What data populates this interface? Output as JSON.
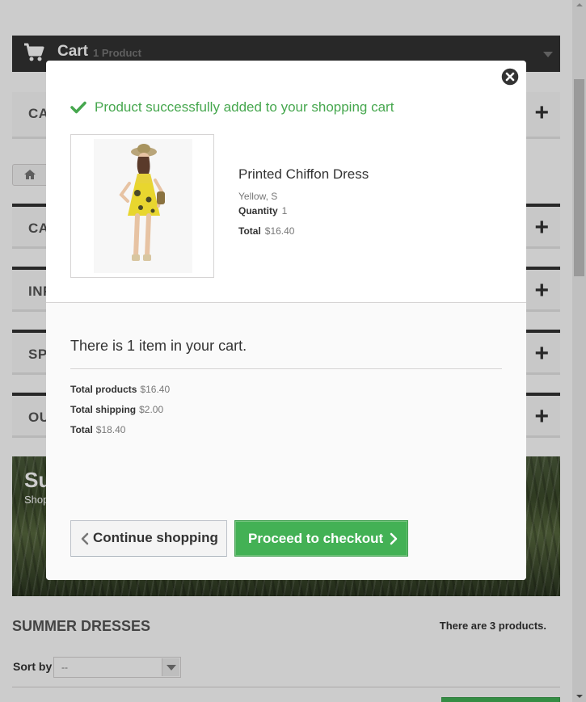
{
  "cart_bar": {
    "title": "Cart",
    "count": "1 Product"
  },
  "side_blocks": [
    {
      "label": "CA"
    },
    {
      "label": "CA"
    },
    {
      "label": "INF"
    },
    {
      "label": "SP"
    },
    {
      "label": "OU"
    }
  ],
  "banner": {
    "title": "Su",
    "subtitle": "Shop"
  },
  "category": {
    "title": "SUMMER DRESSES",
    "count_text": "There are 3 products."
  },
  "sort": {
    "label": "Sort by",
    "value": "--"
  },
  "modal": {
    "success_message": "Product successfully added to your shopping cart",
    "product": {
      "name": "Printed Chiffon Dress",
      "attributes": "Yellow, S",
      "quantity_label": "Quantity",
      "quantity_value": "1",
      "total_label": "Total",
      "total_value": "$16.40"
    },
    "cart_summary": "There is 1 item in your cart.",
    "totals": {
      "products_label": "Total products",
      "products_value": "$16.40",
      "shipping_label": "Total shipping",
      "shipping_value": "$2.00",
      "total_label": "Total",
      "total_value": "$18.40"
    },
    "continue_label": "Continue shopping",
    "checkout_label": "Proceed to checkout"
  },
  "colors": {
    "success_green": "#46a74e",
    "button_green": "#43b155",
    "dark_bar": "#333333"
  }
}
